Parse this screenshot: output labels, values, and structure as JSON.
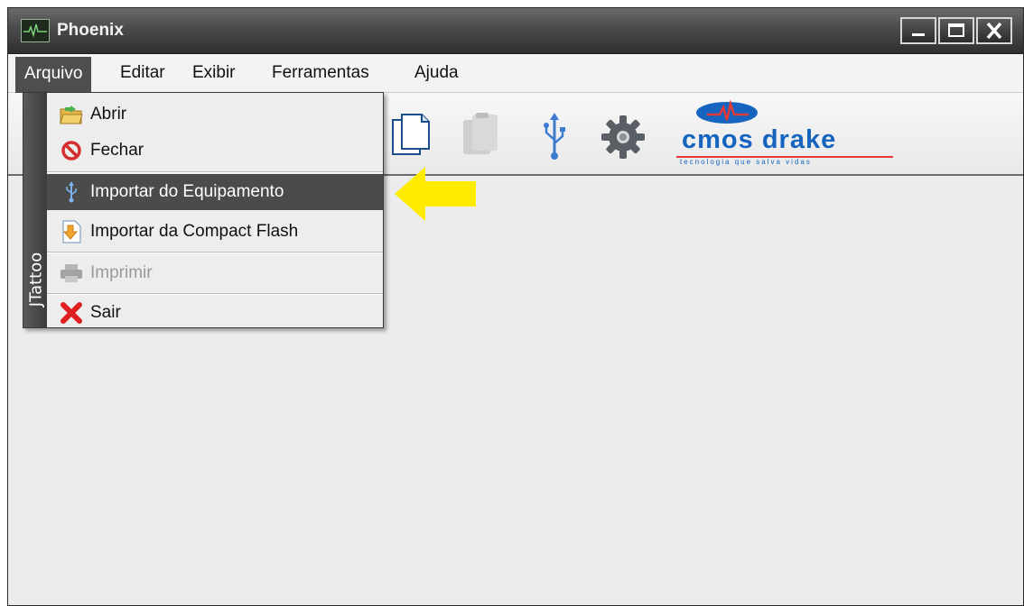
{
  "window": {
    "title": "Phoenix"
  },
  "menubar": {
    "items": [
      {
        "label": "Arquivo"
      },
      {
        "label": "Editar"
      },
      {
        "label": "Exibir"
      },
      {
        "label": "Ferramentas"
      },
      {
        "label": "Ajuda"
      }
    ]
  },
  "dropdown": {
    "strip_label": "JTattoo",
    "items": [
      {
        "label": "Abrir",
        "icon": "open-folder-icon"
      },
      {
        "label": "Fechar",
        "icon": "no-entry-icon"
      },
      {
        "label": "Importar do Equipamento",
        "icon": "usb-icon",
        "highlighted": true
      },
      {
        "label": "Importar da Compact Flash",
        "icon": "import-document-icon"
      },
      {
        "label": "Imprimir",
        "icon": "printer-icon",
        "disabled": true
      },
      {
        "label": "Sair",
        "icon": "red-x-icon"
      }
    ]
  },
  "toolbar": {
    "logo_text": "cmos drake",
    "logo_tagline": "tecnologia que salva vidas"
  },
  "colors": {
    "highlight": "#4b4b4b",
    "arrow": "#ffeb00",
    "logo_blue": "#1565c0",
    "logo_red": "#e53935"
  }
}
